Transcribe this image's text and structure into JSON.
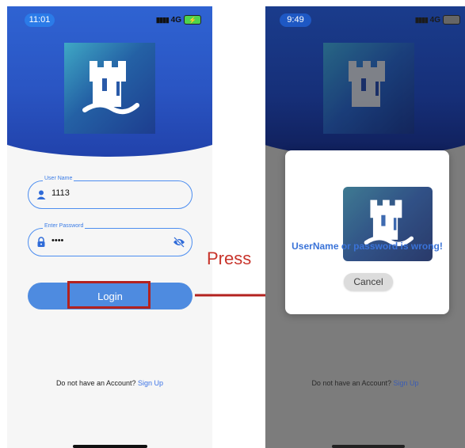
{
  "left": {
    "status": {
      "time": "11:01",
      "signal": "4G"
    },
    "form": {
      "username_label": "User Name",
      "username_value": "1113",
      "password_label": "Enter Password",
      "password_value": "••••"
    },
    "login_label": "Login",
    "signup": {
      "text": "Do not have an Account?",
      "link": "Sign Up"
    }
  },
  "right": {
    "status": {
      "time": "9:49",
      "signal": "4G"
    },
    "dialog": {
      "message": "UserName or password is wrong!",
      "cancel_label": "Cancel"
    },
    "signup": {
      "text": "Do not have an Account?",
      "link": "Sign Up"
    }
  },
  "annotation": {
    "press_label": "Press"
  },
  "colors": {
    "primary_blue": "#4e8be0",
    "header_blue": "#2a55c3",
    "highlight_red": "#b3221f",
    "link_blue": "#3d74e6"
  },
  "icons": {
    "user": "user-icon",
    "lock": "lock-icon",
    "eye_off": "eye-off-icon",
    "logo": "castle-logo"
  }
}
